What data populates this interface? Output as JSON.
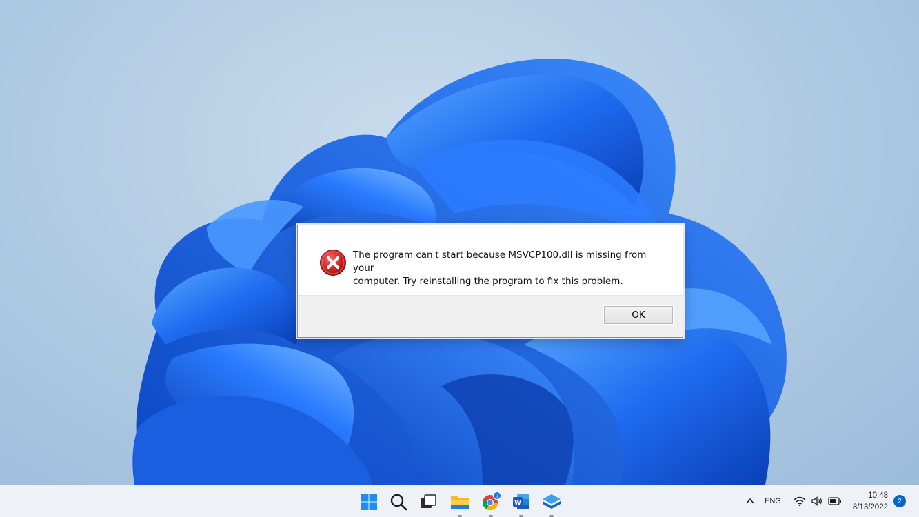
{
  "dialog": {
    "message_line1": "The program can't start because MSVCP100.dll is missing from your",
    "message_line2": "computer. Try reinstalling the program to fix this problem.",
    "ok_label": "OK",
    "icon": "error-icon",
    "error_color": "#c8102e"
  },
  "taskbar": {
    "apps": [
      {
        "name": "start-button",
        "icon": "windows-logo-icon"
      },
      {
        "name": "search-button",
        "icon": "search-icon"
      },
      {
        "name": "task-view-button",
        "icon": "task-view-icon"
      },
      {
        "name": "file-explorer",
        "icon": "folder-icon"
      },
      {
        "name": "chrome",
        "icon": "chrome-icon",
        "badge": "J"
      },
      {
        "name": "word",
        "icon": "word-icon",
        "letter": "W"
      },
      {
        "name": "app-stack",
        "icon": "layers-icon"
      }
    ],
    "tray": {
      "language": "ENG",
      "time": "10:48",
      "date": "8/13/2022",
      "notifications": "2"
    }
  },
  "colors": {
    "bloom_blue": "#1f6cf0",
    "accent": "#0a63c9"
  }
}
